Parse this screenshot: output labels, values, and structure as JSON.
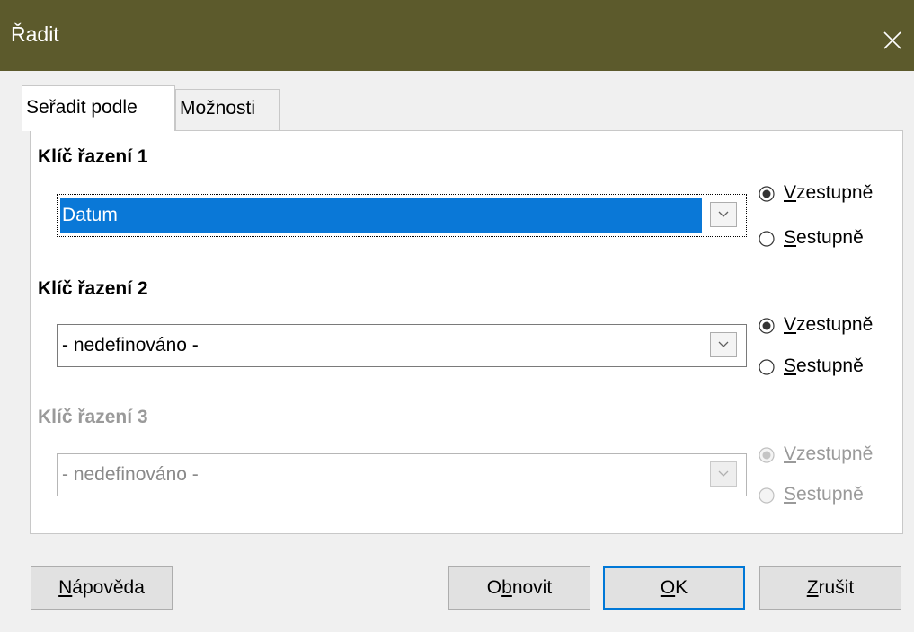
{
  "window": {
    "title": "Řadit"
  },
  "tabs": [
    {
      "label": "Seřadit podle",
      "active": true
    },
    {
      "label": "Možnosti",
      "active": false
    }
  ],
  "keys": [
    {
      "heading": "Klíč řazení 1",
      "value": "Datum",
      "enabled": true,
      "ascending": {
        "key": "V",
        "rest": "zestupně",
        "checked": true
      },
      "descending": {
        "key": "S",
        "rest": "estupně",
        "checked": false
      }
    },
    {
      "heading": "Klíč řazení 2",
      "value": "- nedefinováno -",
      "enabled": true,
      "ascending": {
        "key": "V",
        "rest": "zestupně",
        "checked": true
      },
      "descending": {
        "key": "S",
        "rest": "estupně",
        "checked": false
      }
    },
    {
      "heading": "Klíč řazení 3",
      "value": "- nedefinováno -",
      "enabled": false,
      "ascending": {
        "key": "V",
        "rest": "zestupně",
        "checked": true
      },
      "descending": {
        "key": "S",
        "rest": "estupně",
        "checked": false
      }
    }
  ],
  "buttons": {
    "help": {
      "key": "N",
      "rest": "ápověda"
    },
    "reset": {
      "pre": "O",
      "key": "b",
      "rest": "novit"
    },
    "ok": {
      "key": "O",
      "rest": "K"
    },
    "cancel": {
      "key": "Z",
      "rest": "rušit"
    }
  },
  "colors": {
    "titlebar": "#5c5a2c",
    "selection": "#0a78d7",
    "default_button_border": "#0078d7"
  },
  "icons": {
    "close": "close-icon",
    "dropdown": "chevron-down-icon",
    "radio": "radio-icon"
  }
}
